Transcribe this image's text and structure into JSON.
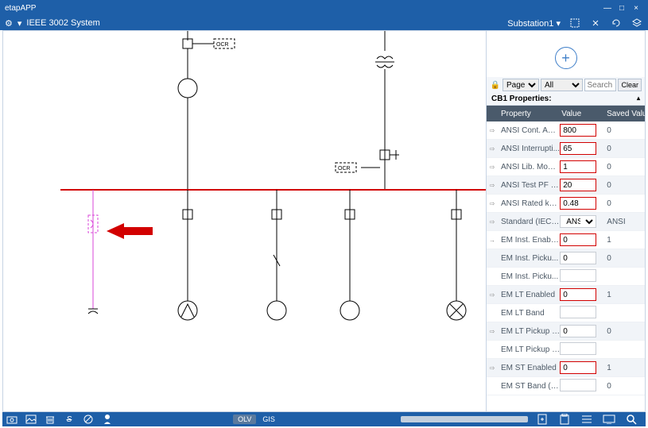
{
  "window": {
    "title": "etapAPP",
    "min": "—",
    "max": "□",
    "close": "×"
  },
  "header": {
    "gear": "⚙",
    "dropdown": "▾",
    "systemName": "IEEE 3002 System",
    "substation": "Substation1",
    "subdrop": "▾"
  },
  "canvas": {
    "label_ocr1": "OCR",
    "label_ocr2": "OCR"
  },
  "sidepanel": {
    "plus": "+",
    "filter": {
      "scope": "Page",
      "group": "All",
      "searchPlaceholder": "Search",
      "clear": "Clear"
    },
    "title": "CB1 Properties:",
    "collapse": "▴",
    "headers": {
      "expand": "",
      "prop": "Property",
      "value": "Value",
      "saved": "Saved Value"
    },
    "rows": [
      {
        "exp": "⇨",
        "prop": "ANSI Cont. Am...",
        "val": "800",
        "saved": "0",
        "editable": true
      },
      {
        "exp": "⇨",
        "prop": "ANSI Interrupti...",
        "val": "65",
        "saved": "0",
        "editable": true,
        "alt": true
      },
      {
        "exp": "⇨",
        "prop": "ANSI Lib. Modi...",
        "val": "1",
        "saved": "0",
        "editable": true
      },
      {
        "exp": "⇨",
        "prop": "ANSI Test PF [%]",
        "val": "20",
        "saved": "0",
        "editable": true,
        "alt": true
      },
      {
        "exp": "⇨",
        "prop": "ANSI Rated kV...",
        "val": "0.48",
        "saved": "0",
        "editable": true
      },
      {
        "exp": "⇨",
        "prop": "Standard (IEC/...",
        "val": "ANSI",
        "saved": "ANSI",
        "select": true,
        "alt": true
      },
      {
        "exp": "→",
        "prop": "EM Inst. Enabled",
        "val": "0",
        "saved": "1",
        "editable": true
      },
      {
        "exp": "",
        "prop": "EM Inst. Picku...",
        "val": "0",
        "saved": "0",
        "gray": true,
        "alt": true
      },
      {
        "exp": "",
        "prop": "EM Inst. Picku...",
        "val": "",
        "saved": "",
        "gray": true
      },
      {
        "exp": "⇨",
        "prop": "EM LT Enabled",
        "val": "0",
        "saved": "1",
        "editable": true,
        "alt": true
      },
      {
        "exp": "",
        "prop": "EM LT Band",
        "val": "",
        "saved": "",
        "gray": true
      },
      {
        "exp": "⇨",
        "prop": "EM LT Pickup (...",
        "val": "0",
        "saved": "0",
        "gray": true,
        "alt": true
      },
      {
        "exp": "",
        "prop": "EM LT Pickup (...",
        "val": "",
        "saved": "",
        "gray": true
      },
      {
        "exp": "⇨",
        "prop": "EM ST Enabled",
        "val": "0",
        "saved": "1",
        "editable": true,
        "alt": true
      },
      {
        "exp": "",
        "prop": "EM ST Band (V...",
        "val": "",
        "saved": "0",
        "gray": true
      }
    ]
  },
  "bottombar": {
    "tab_olv": "OLV",
    "tab_gis": "GIS"
  }
}
